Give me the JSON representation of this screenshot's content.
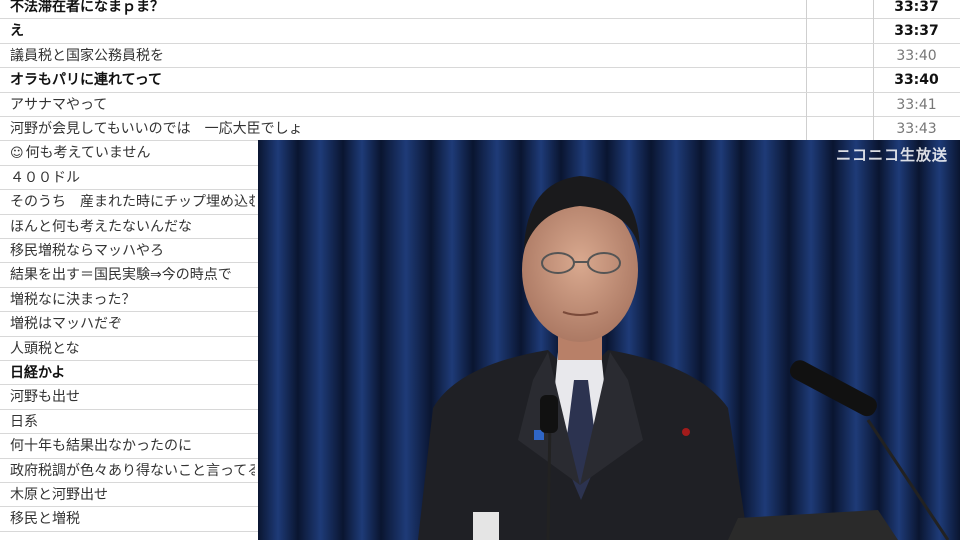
{
  "comments": [
    {
      "text": "不法滞在者になまｐま？",
      "time": "33:37",
      "bold": true
    },
    {
      "text": "え",
      "time": "33:37",
      "bold": true
    },
    {
      "text": "議員税と国家公務員税を",
      "time": "33:40",
      "bold": false
    },
    {
      "text": "オラもパリに連れてって",
      "time": "33:40",
      "bold": true
    },
    {
      "text": "アサナマやって",
      "time": "33:41",
      "bold": false
    },
    {
      "text": "河野が会見してもいいのでは　一応大臣でしょ",
      "time": "33:43",
      "bold": false
    },
    {
      "text": "何も考えていません",
      "icon": "smiley-icon",
      "bold": false
    },
    {
      "text": "４００ドル",
      "bold": false
    },
    {
      "text": "そのうち　産まれた時にチップ埋め込むって",
      "bold": false
    },
    {
      "text": "ほんと何も考えたないんだな",
      "bold": false
    },
    {
      "text": "移民増税ならマッハやろ",
      "bold": false
    },
    {
      "text": "結果を出す＝国民実験⇒今の時点で",
      "bold": false
    },
    {
      "text": "増税なに決まった？",
      "bold": false
    },
    {
      "text": "増税はマッハだぞ",
      "bold": false
    },
    {
      "text": "人頭税とな",
      "bold": false
    },
    {
      "text": "日経かよ",
      "bold": true
    },
    {
      "text": "河野も出せ",
      "bold": false
    },
    {
      "text": "日系",
      "bold": false
    },
    {
      "text": "何十年も結果出なかったのに",
      "bold": false
    },
    {
      "text": "政府税調が色々あり得ないこと言ってる",
      "bold": false
    },
    {
      "text": "木原と河野出せ",
      "bold": false
    },
    {
      "text": "移民と増税",
      "bold": false
    }
  ],
  "video": {
    "watermark": "ニコニコ生放送",
    "colors": {
      "curtain_dark": "#0b1633",
      "curtain_light": "#1d3570",
      "suit": "#1c1d22"
    }
  }
}
